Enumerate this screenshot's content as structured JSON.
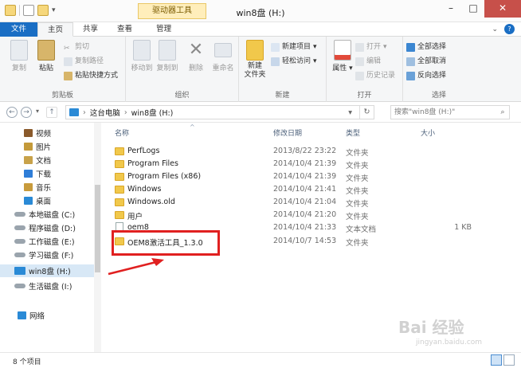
{
  "window": {
    "title": "win8盘 (H:)",
    "context_tab": "驱动器工具"
  },
  "tabs": {
    "file": "文件",
    "home": "主页",
    "share": "共享",
    "view": "查看",
    "manage": "管理"
  },
  "ribbon": {
    "clipboard": {
      "label": "剪贴板",
      "copy": "复制",
      "paste": "粘贴",
      "cut": "剪切",
      "copy_path": "复制路径",
      "paste_shortcut": "粘贴快捷方式"
    },
    "organize": {
      "label": "组织",
      "move_to": "移动到",
      "copy_to": "复制到",
      "delete": "删除",
      "rename": "重命名"
    },
    "new": {
      "label": "新建",
      "new_folder": "新建\n文件夹",
      "new_item": "新建项目",
      "easy_access": "轻松访问"
    },
    "open": {
      "label": "打开",
      "properties": "属性",
      "open": "打开",
      "edit": "编辑",
      "history": "历史记录"
    },
    "select": {
      "label": "选择",
      "select_all": "全部选择",
      "select_none": "全部取消",
      "invert": "反向选择"
    }
  },
  "address": {
    "crumb_pc": "这台电脑",
    "crumb_drive": "win8盘 (H:)",
    "search_placeholder": "搜索\"win8盘 (H:)\""
  },
  "navpane": {
    "items": [
      {
        "label": "视频",
        "color": "#8a5a2b"
      },
      {
        "label": "图片",
        "color": "#c49a3a"
      },
      {
        "label": "文档",
        "color": "#c8a24a"
      },
      {
        "label": "下载",
        "color": "#2f7ed8"
      },
      {
        "label": "音乐",
        "color": "#c89b3c"
      },
      {
        "label": "桌面",
        "color": "#2a8ad6"
      },
      {
        "label": "本地磁盘 (C:)",
        "color": "#9aa4ad"
      },
      {
        "label": "程序磁盘 (D:)",
        "color": "#9aa4ad"
      },
      {
        "label": "工作磁盘 (E:)",
        "color": "#9aa4ad"
      },
      {
        "label": "学习磁盘 (F:)",
        "color": "#9aa4ad"
      },
      {
        "label": "win8盘 (H:)",
        "color": "#2a8ad6"
      },
      {
        "label": "生活磁盘 (I:)",
        "color": "#9aa4ad"
      },
      {
        "label": "网络",
        "color": "#2a8ad6"
      }
    ]
  },
  "filelist": {
    "columns": {
      "name": "名称",
      "date": "修改日期",
      "type": "类型",
      "size": "大小"
    },
    "rows": [
      {
        "name": "PerfLogs",
        "date": "2013/8/22 23:22",
        "type": "文件夹",
        "size": ""
      },
      {
        "name": "Program Files",
        "date": "2014/10/4 21:39",
        "type": "文件夹",
        "size": ""
      },
      {
        "name": "Program Files (x86)",
        "date": "2014/10/4 21:39",
        "type": "文件夹",
        "size": ""
      },
      {
        "name": "Windows",
        "date": "2014/10/4 21:41",
        "type": "文件夹",
        "size": ""
      },
      {
        "name": "Windows.old",
        "date": "2014/10/4 21:04",
        "type": "文件夹",
        "size": ""
      },
      {
        "name": "用户",
        "date": "2014/10/4 21:20",
        "type": "文件夹",
        "size": ""
      },
      {
        "name": "oem8",
        "date": "2014/10/4 21:33",
        "type": "文本文档",
        "size": "1 KB"
      },
      {
        "name": "OEM8激活工具_1.3.0",
        "date": "2014/10/7 14:53",
        "type": "文件夹",
        "size": ""
      }
    ]
  },
  "status": {
    "count": "8 个项目"
  },
  "watermark": {
    "text": "Bai 经验",
    "url": "jingyan.baidu.com"
  }
}
